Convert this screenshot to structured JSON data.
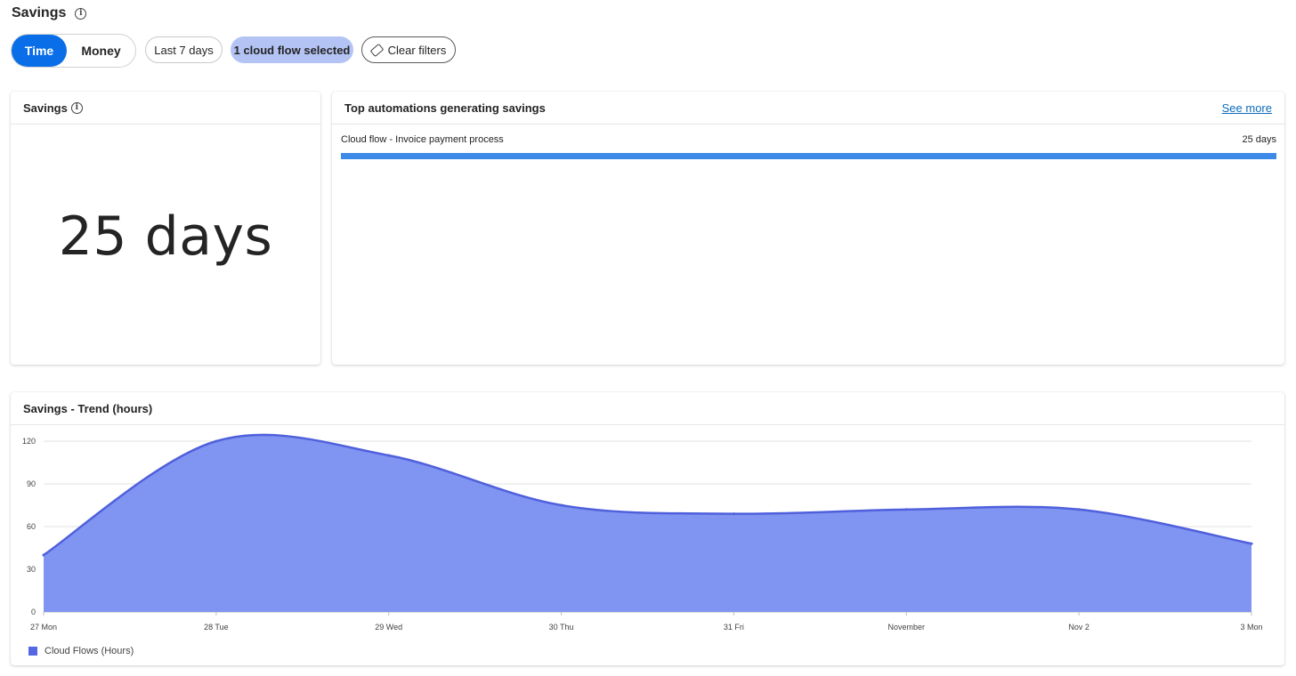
{
  "page": {
    "title": "Savings"
  },
  "filters": {
    "toggle": {
      "options": [
        "Time",
        "Money"
      ],
      "active": "Time"
    },
    "date_range": "Last 7 days",
    "selection": "1 cloud flow selected",
    "clear_label": "Clear filters"
  },
  "kpi": {
    "title": "Savings",
    "value": "25 days"
  },
  "top_automations": {
    "title": "Top automations generating savings",
    "see_more": "See more",
    "items": [
      {
        "name": "Cloud flow - Invoice payment process",
        "value": "25 days",
        "share": 1.0
      }
    ]
  },
  "trend": {
    "title": "Savings - Trend (hours)",
    "legend": "Cloud Flows (Hours)"
  },
  "colors": {
    "accent": "#0a6ee8",
    "area_fill": "#8094f1",
    "area_line": "#4f60dc",
    "bar": "#3d89e8",
    "selected_pill": "#b3c3f3"
  },
  "chart_data": {
    "type": "area",
    "title": "Savings - Trend (hours)",
    "categories": [
      "27 Mon",
      "28 Tue",
      "29 Wed",
      "30 Thu",
      "31 Fri",
      "November",
      "Nov 2",
      "3 Mon"
    ],
    "series": [
      {
        "name": "Cloud Flows (Hours)",
        "values": [
          40,
          120,
          110,
          75,
          69,
          72,
          72,
          48
        ]
      }
    ],
    "yticks": [
      0,
      30,
      60,
      90,
      120
    ],
    "ylim": [
      0,
      120
    ],
    "grid": true,
    "legend_position": "bottom-left"
  }
}
